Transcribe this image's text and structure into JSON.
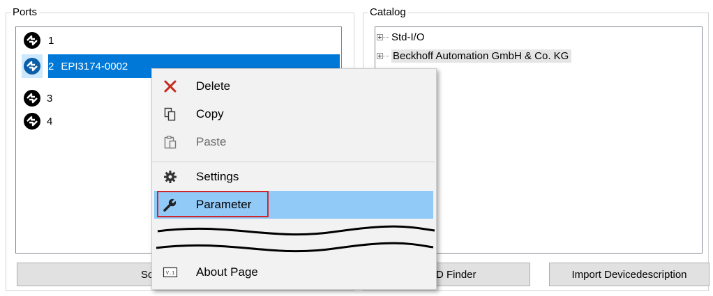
{
  "ports": {
    "title": "Ports",
    "items": [
      {
        "num": "1",
        "name": ""
      },
      {
        "num": "2",
        "name": "EPI3174-0002"
      },
      {
        "num": "3",
        "name": ""
      },
      {
        "num": "4",
        "name": ""
      }
    ],
    "button_label": "Sc"
  },
  "catalog": {
    "title": "Catalog",
    "items": [
      {
        "label": "Std-I/O"
      },
      {
        "label": "Beckhoff Automation GmbH & Co. KG"
      }
    ],
    "finder_label": "D Finder",
    "import_label": "Import Devicedescription"
  },
  "context_menu": {
    "items": [
      {
        "label": "Delete",
        "icon": "delete-x-icon",
        "color": "#c42b1c"
      },
      {
        "label": "Copy",
        "icon": "copy-icon"
      },
      {
        "label": "Paste",
        "icon": "paste-icon"
      },
      {
        "label": "Settings",
        "icon": "gear-icon"
      },
      {
        "label": "Parameter",
        "icon": "wrench-icon"
      },
      {
        "label": "About Page",
        "icon": "about-icon",
        "icon_text": "V.1"
      }
    ]
  },
  "colors": {
    "selection": "#0078d7",
    "menu_hover": "#91c9f7",
    "highlight_border": "#d0262b"
  }
}
